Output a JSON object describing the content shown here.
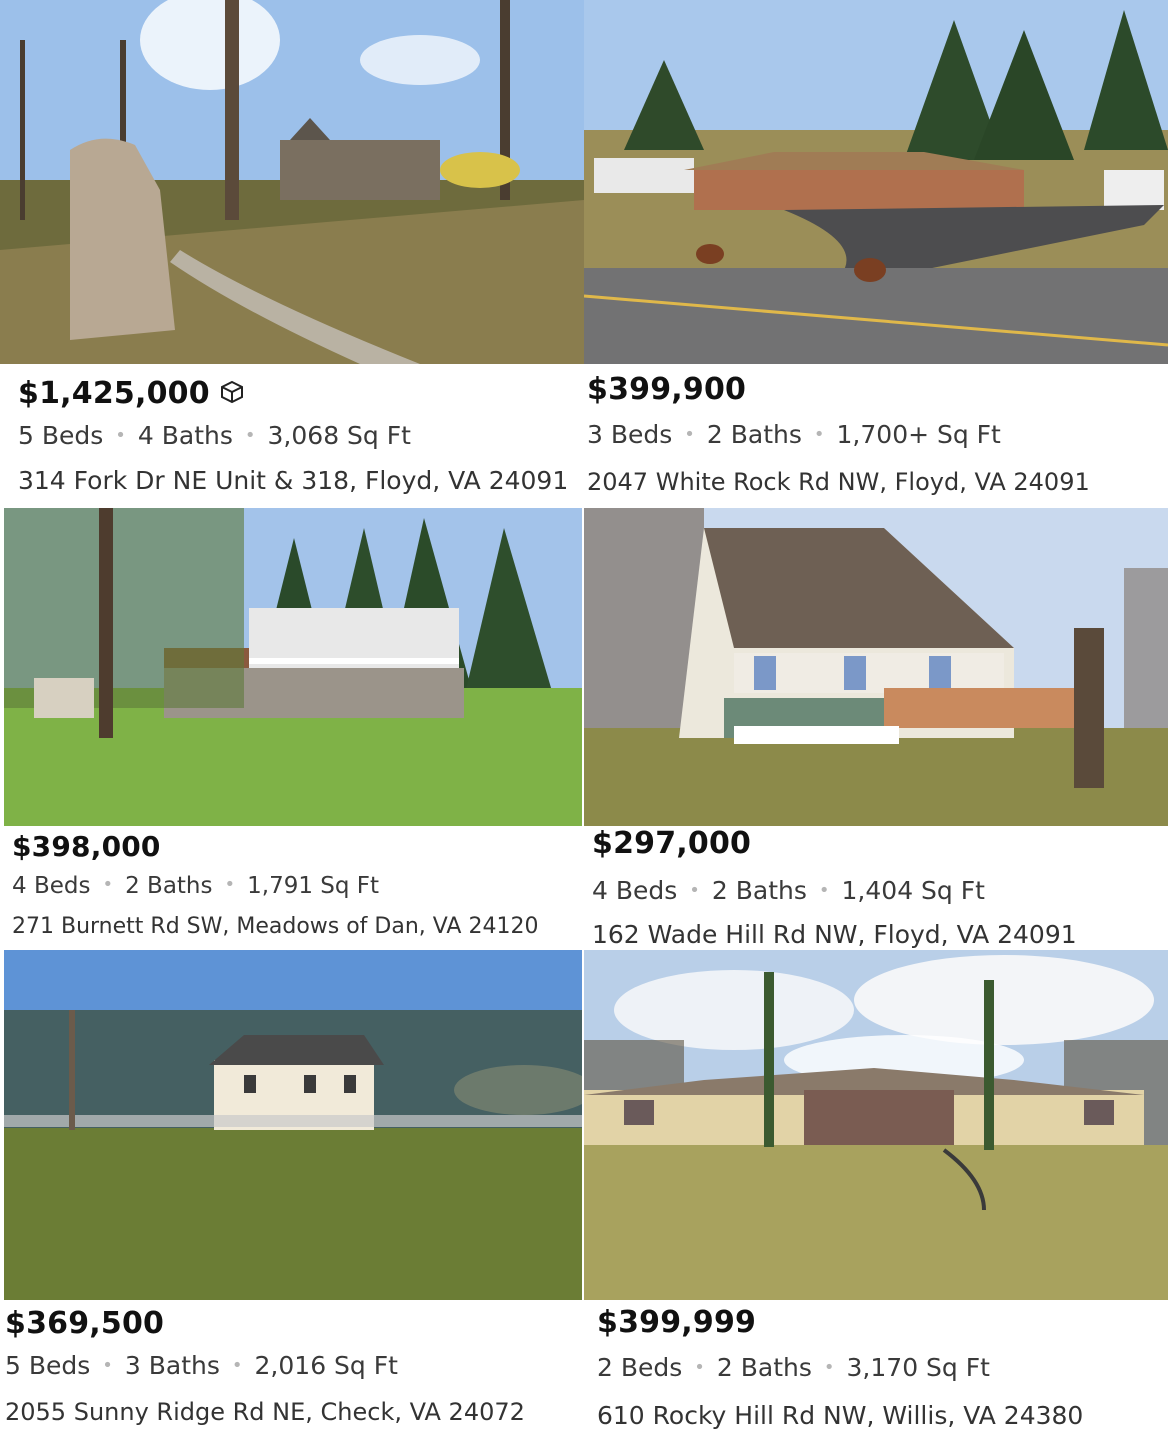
{
  "listings": [
    {
      "price": "$1,425,000",
      "beds": "5 Beds",
      "baths": "4 Baths",
      "sqft": "3,068 Sq Ft",
      "address": "314 Fork Dr NE Unit & 318, Floyd, VA 24091",
      "badge_icon": "3d-tour-cube-icon"
    },
    {
      "price": "$399,900",
      "beds": "3 Beds",
      "baths": "2 Baths",
      "sqft": "1,700+ Sq Ft",
      "address": "2047 White Rock Rd NW, Floyd, VA 24091"
    },
    {
      "price": "$398,000",
      "beds": "4 Beds",
      "baths": "2 Baths",
      "sqft": "1,791 Sq Ft",
      "address": "271 Burnett Rd SW, Meadows of Dan, VA 24120"
    },
    {
      "price": "$297,000",
      "beds": "4 Beds",
      "baths": "2 Baths",
      "sqft": "1,404 Sq Ft",
      "address": "162 Wade Hill Rd NW, Floyd, VA 24091"
    },
    {
      "price": "$369,500",
      "beds": "5 Beds",
      "baths": "3 Baths",
      "sqft": "2,016 Sq Ft",
      "address": "2055 Sunny Ridge Rd NE, Check, VA 24072"
    },
    {
      "price": "$399,999",
      "beds": "2 Beds",
      "baths": "2 Baths",
      "sqft": "3,170 Sq Ft",
      "address": "610 Rocky Hill Rd NW, Willis, VA 24380"
    }
  ],
  "separator": "•"
}
